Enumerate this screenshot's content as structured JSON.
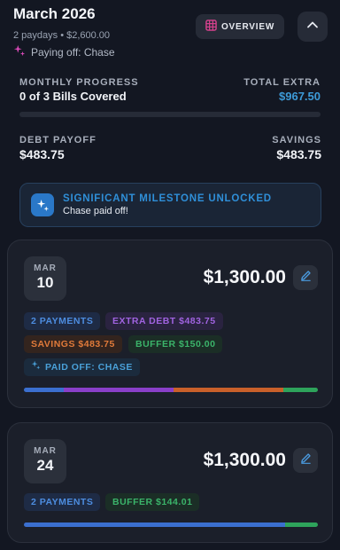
{
  "header": {
    "title": "March 2026",
    "paydays": "2 paydays • $2,600.00",
    "paying_off": "Paying off: Chase",
    "overview_label": "OVERVIEW"
  },
  "progress": {
    "label": "MONTHLY PROGRESS",
    "value": "0 of 3 Bills Covered",
    "fraction": 0,
    "extra_label": "TOTAL EXTRA",
    "extra_value": "$967.50"
  },
  "payoff": {
    "debt_label": "DEBT PAYOFF",
    "debt_value": "$483.75",
    "savings_label": "SAVINGS",
    "savings_value": "$483.75"
  },
  "milestone": {
    "title": "SIGNIFICANT MILESTONE UNLOCKED",
    "subtitle": "Chase paid off!"
  },
  "cards": [
    {
      "month": "MAR",
      "day": "10",
      "amount": "$1,300.00",
      "chips": {
        "payments": "2 PAYMENTS",
        "extra_debt": "EXTRA DEBT $483.75",
        "savings": "SAVINGS $483.75",
        "buffer": "BUFFER $150.00",
        "paid_off": "PAID OFF: CHASE"
      },
      "segments": [
        {
          "share": 0.137,
          "color": "#3b6fcf"
        },
        {
          "share": 0.373,
          "color": "#8a3fc9"
        },
        {
          "share": 0.373,
          "color": "#c9602a"
        },
        {
          "share": 0.117,
          "color": "#2ea35b"
        }
      ]
    },
    {
      "month": "MAR",
      "day": "24",
      "amount": "$1,300.00",
      "chips": {
        "payments": "2 PAYMENTS",
        "buffer": "BUFFER $144.01"
      },
      "segments": [
        {
          "share": 0.889,
          "color": "#3b6fcf"
        },
        {
          "share": 0.111,
          "color": "#2ea35b"
        }
      ]
    }
  ],
  "colors": {
    "accent": "#3d9bd8",
    "background": "#131722"
  }
}
